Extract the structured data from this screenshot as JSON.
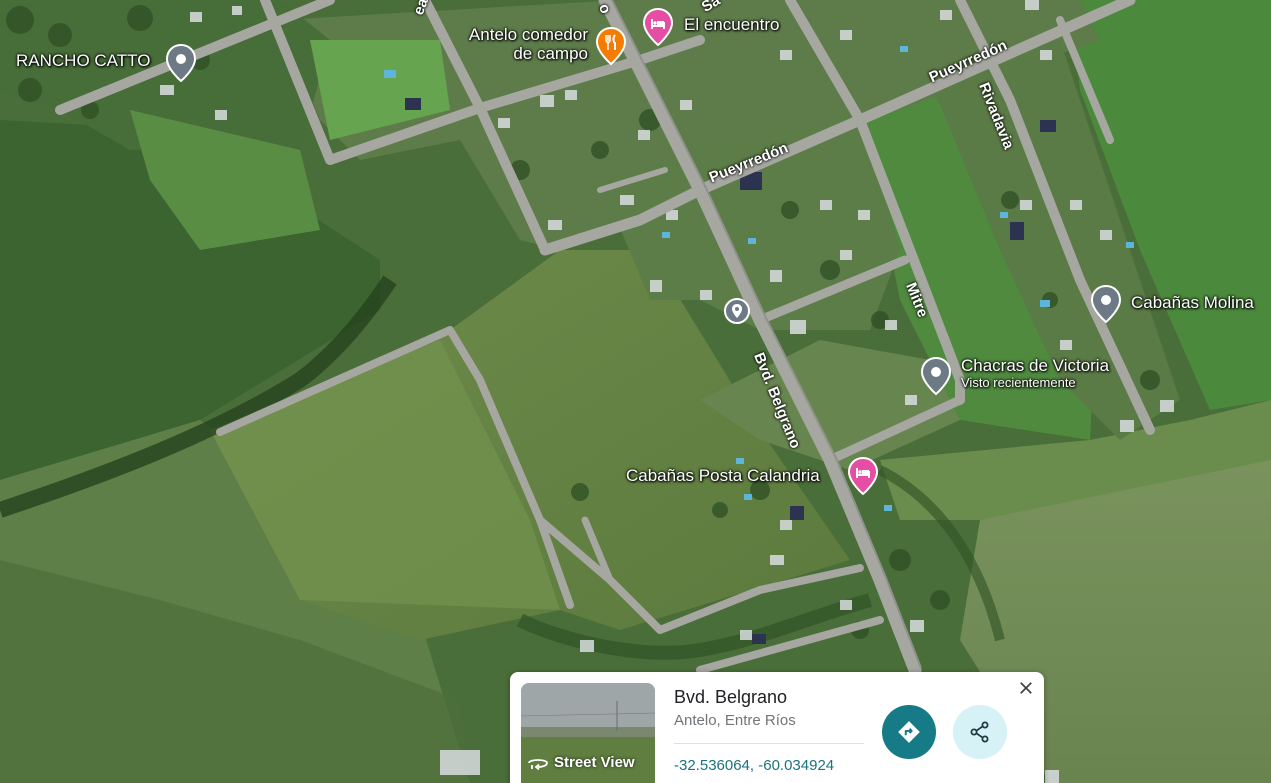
{
  "map": {
    "places": {
      "rancho_catto": "RANCHO CATTO",
      "antelo_comedor_line1": "Antelo comedor",
      "antelo_comedor_line2": "de campo",
      "el_encuentro": "El encuentro",
      "cabanas_molina": "Cabañas Molina",
      "chacras_de_victoria": "Chacras de Victoria",
      "chacras_subtitle": "Visto recientemente",
      "cabanas_posta_calandria": "Cabañas Posta Calandria"
    },
    "streets": {
      "pueyrredon_1": "Pueyrredón",
      "pueyrredon_2": "Pueyrredón",
      "rivadavia": "Rivadavia",
      "mitre": "Mitre",
      "bvd_belgrano": "Bvd. Belgrano",
      "top_partial_1": "ear",
      "top_partial_2": "o",
      "top_partial_3": "Sa"
    },
    "colors": {
      "pin_hotel": "#e64ea4",
      "pin_restaurant": "#f57c00",
      "pin_generic": "#6d7a86"
    }
  },
  "card": {
    "street_view_label": "Street View",
    "title": "Bvd. Belgrano",
    "subtitle": "Antelo, Entre Ríos",
    "coordinates": "-32.536064, -60.034924",
    "icons": {
      "close": "close-icon",
      "directions": "directions-icon",
      "share": "share-icon",
      "street_view": "street-view-icon"
    },
    "colors": {
      "directions_bg": "#167b87",
      "share_bg": "#d6f2f7",
      "coords_text": "#1a7380"
    }
  }
}
